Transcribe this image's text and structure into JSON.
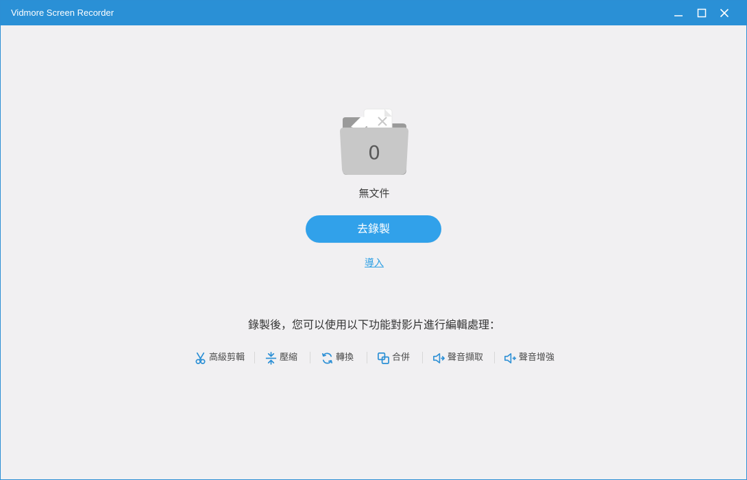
{
  "window": {
    "title": "Vidmore Screen Recorder",
    "controls": {
      "minimize_icon": "minimize-icon",
      "maximize_icon": "maximize-icon",
      "close_icon": "close-icon"
    }
  },
  "empty_state": {
    "folder_icon": "empty-folder-icon",
    "file_count": "0",
    "label": "無文件"
  },
  "actions": {
    "record_label": "去錄製",
    "import_label": "導入"
  },
  "features": {
    "prompt": "錄製後，您可以使用以下功能對影片進行編輯處理：",
    "items": [
      {
        "label": "高級剪輯",
        "icon": "scissors-icon"
      },
      {
        "label": "壓縮",
        "icon": "compress-icon"
      },
      {
        "label": "轉換",
        "icon": "convert-icon"
      },
      {
        "label": "合併",
        "icon": "merge-icon"
      },
      {
        "label": "聲音擷取",
        "icon": "audio-extract-icon"
      },
      {
        "label": "聲音增強",
        "icon": "audio-enhance-icon"
      }
    ]
  },
  "colors": {
    "titlebar": "#2a90d6",
    "background": "#f1f0f2",
    "accent": "#31a1ea",
    "link": "#2c9fe4",
    "folder": "#c8c8c8"
  }
}
